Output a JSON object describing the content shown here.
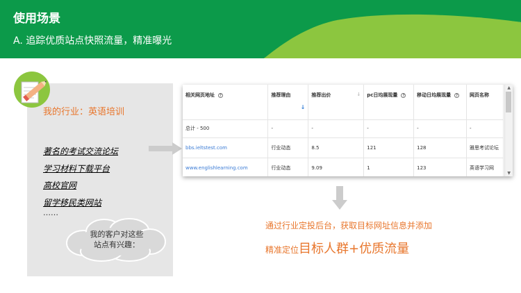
{
  "header": {
    "title": "使用场景",
    "subtitle": "A. 追踪优质站点快照流量，精准曝光"
  },
  "left": {
    "industry": "我的行业：英语培训",
    "sites": [
      "著名的考试交流论坛",
      "学习材料下载平台",
      "高校官网",
      "留学移民类网站"
    ],
    "ellipsis": "……",
    "cloud_line1": "我的客户对这些",
    "cloud_line2": "站点有兴趣："
  },
  "table": {
    "headers": [
      "相关网页地址",
      "推荐理由",
      "推荐出价",
      "pc日均展现量",
      "移动日均展现量",
      "网页名称"
    ],
    "total": [
      "总计 - 500",
      "-",
      "-",
      "-",
      "-",
      "-"
    ],
    "rows": [
      [
        "bbs.ieltstest.com",
        "行业动态",
        "8.5",
        "121",
        "128",
        "雅思考试论坛"
      ],
      [
        "www.englishlearning.com",
        "行业动态",
        "9.09",
        "1",
        "123",
        "英语学习网"
      ]
    ],
    "help_glyph": "?",
    "sort_glyph": "↓",
    "active_sort_glyph": "↓"
  },
  "bottom": {
    "description": "通过行业定投后台，获取目标网址信息并添加",
    "target_prefix": "精准定位",
    "target_highlight": "目标人群+优质流量"
  },
  "colors": {
    "green_dark": "#0c9a4a",
    "green_light": "#8cc63f",
    "orange": "#e8762c",
    "panel_grey": "#e6e6e6",
    "link_blue": "#3a7bd5"
  }
}
